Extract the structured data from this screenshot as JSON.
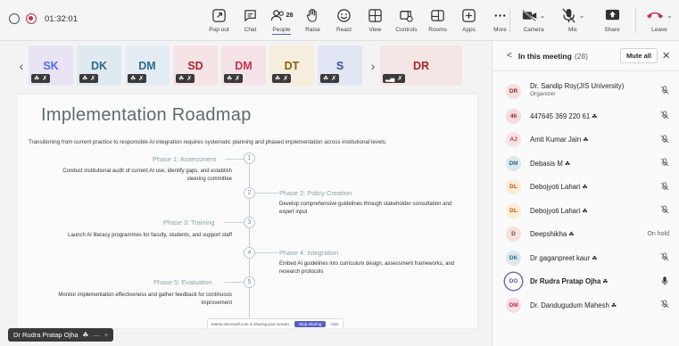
{
  "meeting": {
    "timer": "01:32:01"
  },
  "toolbar": {
    "tools": [
      {
        "label": "Pop out",
        "icon": "pop-out-icon"
      },
      {
        "label": "Chat",
        "icon": "chat-icon"
      },
      {
        "label": "People",
        "icon": "people-icon",
        "count": "28",
        "active": true
      },
      {
        "label": "Raise",
        "icon": "hand-icon"
      },
      {
        "label": "React",
        "icon": "smile-icon"
      },
      {
        "label": "View",
        "icon": "grid-icon"
      },
      {
        "label": "Controls",
        "icon": "controls-icon"
      },
      {
        "label": "Rooms",
        "icon": "rooms-icon"
      },
      {
        "label": "Apps",
        "icon": "apps-icon"
      },
      {
        "label": "More",
        "icon": "more-icon"
      }
    ],
    "camera_label": "Camera",
    "mic_label": "Mic",
    "share_label": "Share",
    "leave_label": "Leave"
  },
  "thumbnails": [
    {
      "initials": "SK",
      "bg": "#e8e4f3",
      "fg": "#4f6bed"
    },
    {
      "initials": "DK",
      "bg": "#dfeaf0",
      "fg": "#2b6d8a"
    },
    {
      "initials": "DM",
      "bg": "#e4ecf3",
      "fg": "#2b6d8a"
    },
    {
      "initials": "SD",
      "bg": "#f6e3e6",
      "fg": "#a4262c"
    },
    {
      "initials": "DM",
      "bg": "#f6e3e8",
      "fg": "#c4314b"
    },
    {
      "initials": "DT",
      "bg": "#f6eedc",
      "fg": "#8a5d10"
    },
    {
      "initials": "S",
      "bg": "#e2e6f4",
      "fg": "#3b4ea0"
    },
    {
      "initials": "DR",
      "bg": "#f4e6e4",
      "fg": "#a4262c"
    }
  ],
  "slide": {
    "title": "Implementation Roadmap",
    "subtitle": "Transitioning from current practice to responsible AI integration requires systematic planning and phased implementation across institutional levels.",
    "phases": [
      {
        "num": "1",
        "title": "Phase 1: Assessment",
        "desc": "Conduct institutional audit of current AI use, identify gaps, and establish steering committee"
      },
      {
        "num": "2",
        "title": "Phase 2: Policy Creation",
        "desc": "Develop comprehensive guidelines through stakeholder consultation and expert input"
      },
      {
        "num": "3",
        "title": "Phase 3: Training",
        "desc": "Launch AI literacy programmes for faculty, students, and support staff"
      },
      {
        "num": "4",
        "title": "Phase 4: Integration",
        "desc": "Embed AI guidelines into curriculum design, assessment frameworks, and research protocols"
      },
      {
        "num": "5",
        "title": "Phase 5: Evaluation",
        "desc": "Monitor implementation effectiveness and gather feedback for continuous improvement"
      }
    ],
    "share_notice": "teams.microsoft.com is sharing your screen.",
    "stop_sharing": "Stop sharing",
    "hide": "Hide"
  },
  "presenter": {
    "name": "Dr Rudra Pratap Ojha"
  },
  "panel": {
    "title": "In this meeting",
    "count": "(28)",
    "mute_all": "Mute all",
    "participants": [
      {
        "initials": "DR",
        "name": "Dr. Sandip Roy(JIS University)",
        "role": "Organizer",
        "bg": "#f3e1df",
        "fg": "#a4262c",
        "status": "mic-off"
      },
      {
        "initials": "46",
        "name": "447645 369 220 61",
        "bg": "#f6dcdc",
        "fg": "#a4262c",
        "guest": true,
        "status": "mic-off"
      },
      {
        "initials": "AJ",
        "name": "Amit Kumar Jain",
        "bg": "#fbe2e4",
        "fg": "#c4314b",
        "guest": true,
        "status": "mic-off"
      },
      {
        "initials": "DM",
        "name": "Debasis M",
        "bg": "#dde8ee",
        "fg": "#2b6d8a",
        "guest": true,
        "status": "mic-off"
      },
      {
        "initials": "DL",
        "name": "Debojyoti Lahari",
        "bg": "#fbecd7",
        "fg": "#b65c06",
        "guest": true,
        "status": "mic-off"
      },
      {
        "initials": "DL",
        "name": "Debojyoti Lahari",
        "bg": "#fbecd7",
        "fg": "#b65c06",
        "guest": true,
        "status": "mic-off"
      },
      {
        "initials": "D",
        "name": "Deepshikha",
        "bg": "#f4e2dc",
        "fg": "#8a3d1e",
        "guest": true,
        "status": "text",
        "status_text": "On hold"
      },
      {
        "initials": "DK",
        "name": "Dr gaganpreet kaur",
        "bg": "#dce8ee",
        "fg": "#2b6d8a",
        "guest": true,
        "status": "mic-off"
      },
      {
        "initials": "DO",
        "name": "Dr Rudra Pratap Ojha",
        "bg": "#ffffff",
        "fg": "#6b4ea8",
        "guest": true,
        "bold": true,
        "ring": true,
        "status": "mic-on"
      },
      {
        "initials": "DM",
        "name": "Dr. Dandugudum Mahesh",
        "bg": "#f7dde4",
        "fg": "#c4314b",
        "guest": true,
        "status": "mic-off"
      }
    ]
  }
}
